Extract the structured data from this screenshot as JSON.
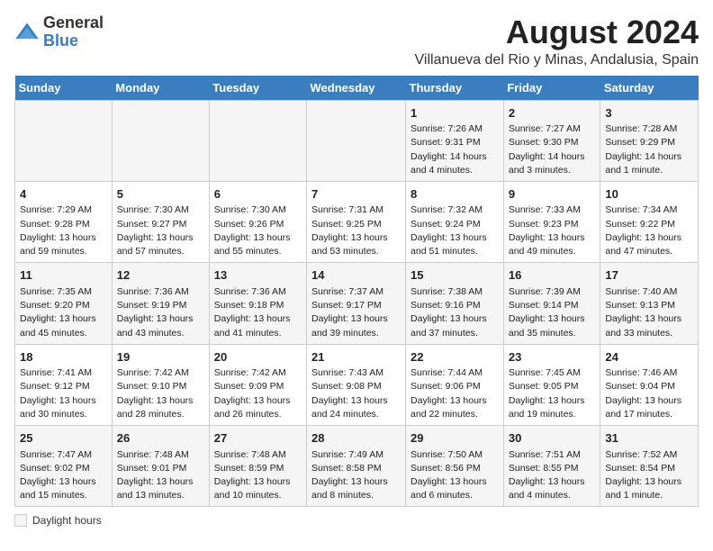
{
  "logo": {
    "general": "General",
    "blue": "Blue"
  },
  "title": "August 2024",
  "location": "Villanueva del Rio y Minas, Andalusia, Spain",
  "days_of_week": [
    "Sunday",
    "Monday",
    "Tuesday",
    "Wednesday",
    "Thursday",
    "Friday",
    "Saturday"
  ],
  "weeks": [
    [
      {
        "day": "",
        "info": ""
      },
      {
        "day": "",
        "info": ""
      },
      {
        "day": "",
        "info": ""
      },
      {
        "day": "",
        "info": ""
      },
      {
        "day": "1",
        "info": "Sunrise: 7:26 AM\nSunset: 9:31 PM\nDaylight: 14 hours\nand 4 minutes."
      },
      {
        "day": "2",
        "info": "Sunrise: 7:27 AM\nSunset: 9:30 PM\nDaylight: 14 hours\nand 3 minutes."
      },
      {
        "day": "3",
        "info": "Sunrise: 7:28 AM\nSunset: 9:29 PM\nDaylight: 14 hours\nand 1 minute."
      }
    ],
    [
      {
        "day": "4",
        "info": "Sunrise: 7:29 AM\nSunset: 9:28 PM\nDaylight: 13 hours\nand 59 minutes."
      },
      {
        "day": "5",
        "info": "Sunrise: 7:30 AM\nSunset: 9:27 PM\nDaylight: 13 hours\nand 57 minutes."
      },
      {
        "day": "6",
        "info": "Sunrise: 7:30 AM\nSunset: 9:26 PM\nDaylight: 13 hours\nand 55 minutes."
      },
      {
        "day": "7",
        "info": "Sunrise: 7:31 AM\nSunset: 9:25 PM\nDaylight: 13 hours\nand 53 minutes."
      },
      {
        "day": "8",
        "info": "Sunrise: 7:32 AM\nSunset: 9:24 PM\nDaylight: 13 hours\nand 51 minutes."
      },
      {
        "day": "9",
        "info": "Sunrise: 7:33 AM\nSunset: 9:23 PM\nDaylight: 13 hours\nand 49 minutes."
      },
      {
        "day": "10",
        "info": "Sunrise: 7:34 AM\nSunset: 9:22 PM\nDaylight: 13 hours\nand 47 minutes."
      }
    ],
    [
      {
        "day": "11",
        "info": "Sunrise: 7:35 AM\nSunset: 9:20 PM\nDaylight: 13 hours\nand 45 minutes."
      },
      {
        "day": "12",
        "info": "Sunrise: 7:36 AM\nSunset: 9:19 PM\nDaylight: 13 hours\nand 43 minutes."
      },
      {
        "day": "13",
        "info": "Sunrise: 7:36 AM\nSunset: 9:18 PM\nDaylight: 13 hours\nand 41 minutes."
      },
      {
        "day": "14",
        "info": "Sunrise: 7:37 AM\nSunset: 9:17 PM\nDaylight: 13 hours\nand 39 minutes."
      },
      {
        "day": "15",
        "info": "Sunrise: 7:38 AM\nSunset: 9:16 PM\nDaylight: 13 hours\nand 37 minutes."
      },
      {
        "day": "16",
        "info": "Sunrise: 7:39 AM\nSunset: 9:14 PM\nDaylight: 13 hours\nand 35 minutes."
      },
      {
        "day": "17",
        "info": "Sunrise: 7:40 AM\nSunset: 9:13 PM\nDaylight: 13 hours\nand 33 minutes."
      }
    ],
    [
      {
        "day": "18",
        "info": "Sunrise: 7:41 AM\nSunset: 9:12 PM\nDaylight: 13 hours\nand 30 minutes."
      },
      {
        "day": "19",
        "info": "Sunrise: 7:42 AM\nSunset: 9:10 PM\nDaylight: 13 hours\nand 28 minutes."
      },
      {
        "day": "20",
        "info": "Sunrise: 7:42 AM\nSunset: 9:09 PM\nDaylight: 13 hours\nand 26 minutes."
      },
      {
        "day": "21",
        "info": "Sunrise: 7:43 AM\nSunset: 9:08 PM\nDaylight: 13 hours\nand 24 minutes."
      },
      {
        "day": "22",
        "info": "Sunrise: 7:44 AM\nSunset: 9:06 PM\nDaylight: 13 hours\nand 22 minutes."
      },
      {
        "day": "23",
        "info": "Sunrise: 7:45 AM\nSunset: 9:05 PM\nDaylight: 13 hours\nand 19 minutes."
      },
      {
        "day": "24",
        "info": "Sunrise: 7:46 AM\nSunset: 9:04 PM\nDaylight: 13 hours\nand 17 minutes."
      }
    ],
    [
      {
        "day": "25",
        "info": "Sunrise: 7:47 AM\nSunset: 9:02 PM\nDaylight: 13 hours\nand 15 minutes."
      },
      {
        "day": "26",
        "info": "Sunrise: 7:48 AM\nSunset: 9:01 PM\nDaylight: 13 hours\nand 13 minutes."
      },
      {
        "day": "27",
        "info": "Sunrise: 7:48 AM\nSunset: 8:59 PM\nDaylight: 13 hours\nand 10 minutes."
      },
      {
        "day": "28",
        "info": "Sunrise: 7:49 AM\nSunset: 8:58 PM\nDaylight: 13 hours\nand 8 minutes."
      },
      {
        "day": "29",
        "info": "Sunrise: 7:50 AM\nSunset: 8:56 PM\nDaylight: 13 hours\nand 6 minutes."
      },
      {
        "day": "30",
        "info": "Sunrise: 7:51 AM\nSunset: 8:55 PM\nDaylight: 13 hours\nand 4 minutes."
      },
      {
        "day": "31",
        "info": "Sunrise: 7:52 AM\nSunset: 8:54 PM\nDaylight: 13 hours\nand 1 minute."
      }
    ]
  ],
  "footer": {
    "daylight_label": "Daylight hours"
  }
}
